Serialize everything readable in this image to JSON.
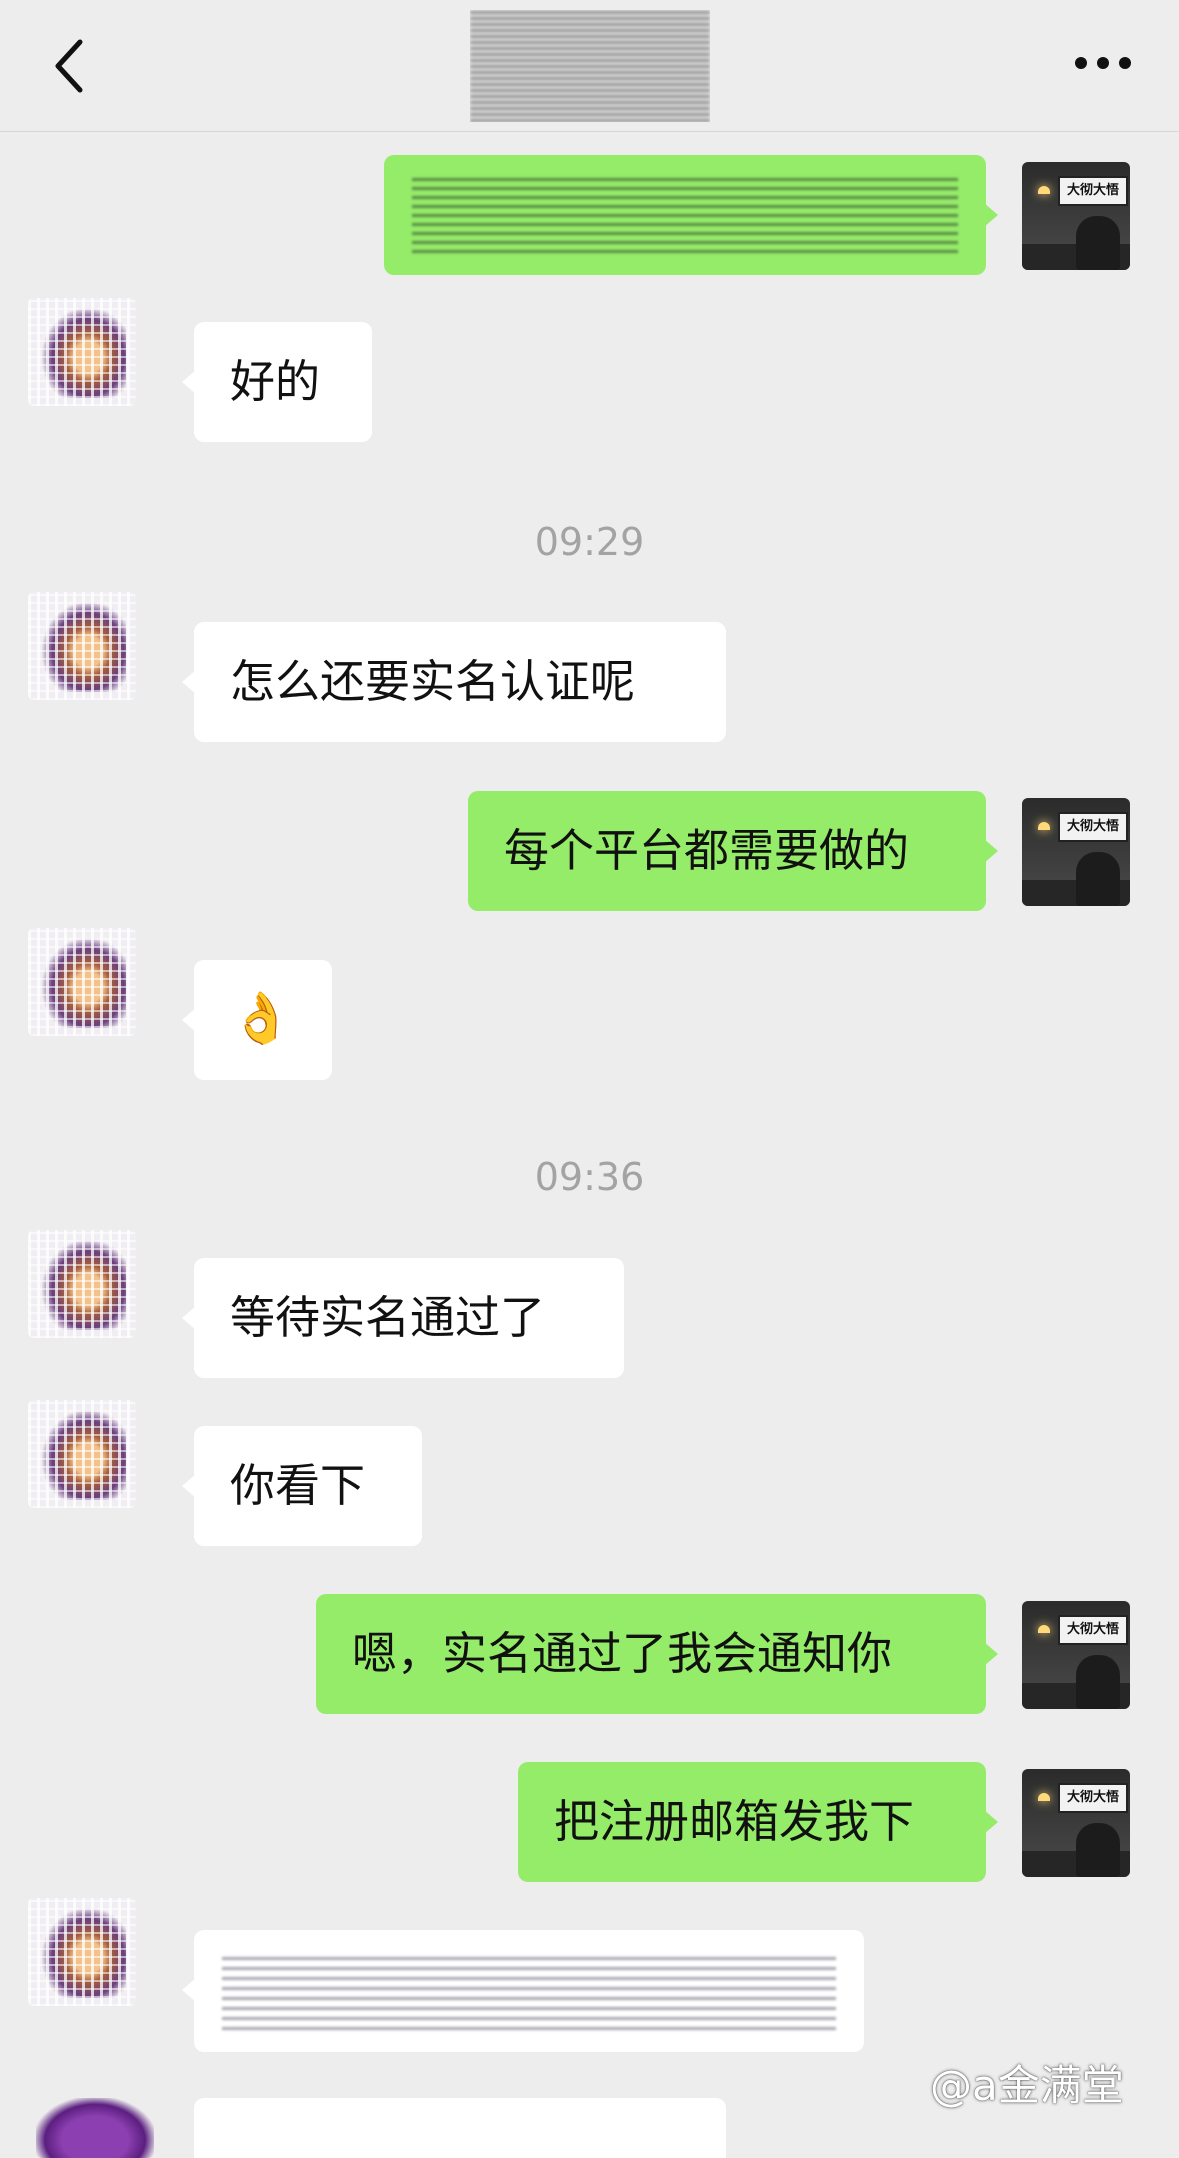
{
  "header": {
    "back_icon": "chevron-left-icon",
    "title": "",
    "more_icon": "more-horizontal-icon"
  },
  "messages": [
    {
      "side": "me",
      "text": ""
    },
    {
      "side": "other",
      "text": "好的"
    },
    {
      "type": "time",
      "text": "09:29"
    },
    {
      "side": "other",
      "text": "怎么还要实名认证呢"
    },
    {
      "side": "me",
      "text": "每个平台都需要做的"
    },
    {
      "side": "other",
      "emoji": "ok-hand-emoji",
      "text": "👌"
    },
    {
      "type": "time",
      "text": "09:36"
    },
    {
      "side": "other",
      "text": "等待实名通过了"
    },
    {
      "side": "other",
      "text": "你看下"
    },
    {
      "side": "me",
      "text": "嗯，实名通过了我会通知你"
    },
    {
      "side": "me",
      "text": "把注册邮箱发我下"
    },
    {
      "side": "other",
      "text": ""
    }
  ],
  "avatar_me": {
    "sign_text": "大彻大悟"
  },
  "watermark": "@a金满堂",
  "colors": {
    "background": "#ededed",
    "bubble_me": "#95ec69",
    "bubble_other": "#ffffff",
    "timestamp": "#a3a3a3"
  }
}
